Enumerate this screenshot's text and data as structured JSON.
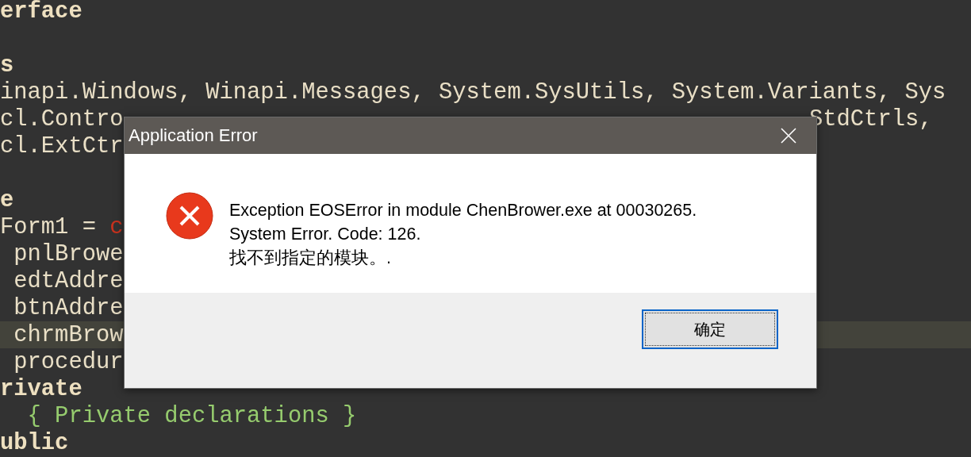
{
  "editor": {
    "lines": [
      {
        "left": [
          {
            "text": "erface",
            "kind": "keyword"
          }
        ],
        "current": false
      },
      {
        "current": false
      },
      {
        "left": [
          {
            "text": "s",
            "kind": "keyword"
          }
        ],
        "current": false
      },
      {
        "left": [
          {
            "text": "inapi.Windows, Winapi.Messages, System.SysUtils, System.Variants, Sys",
            "kind": "plain"
          }
        ],
        "current": false
      },
      {
        "left": [
          {
            "text": "cl.Contro",
            "kind": "plain"
          }
        ],
        "right": [
          {
            "text": "StdCtrls,",
            "kind": "plain"
          }
        ],
        "current": false
      },
      {
        "left": [
          {
            "text": "cl.ExtCtr",
            "kind": "plain"
          }
        ],
        "current": false
      },
      {
        "current": false
      },
      {
        "left": [
          {
            "text": "e",
            "kind": "keyword"
          }
        ],
        "current": false
      },
      {
        "left": [
          {
            "text": "Form1 = ",
            "kind": "plain"
          },
          {
            "text": "c",
            "kind": "string"
          }
        ],
        "current": false
      },
      {
        "left": [
          {
            "text": " pnlBrowe",
            "kind": "plain"
          }
        ],
        "current": false
      },
      {
        "left": [
          {
            "text": " edtAddre",
            "kind": "plain"
          }
        ],
        "current": false
      },
      {
        "left": [
          {
            "text": " btnAddre",
            "kind": "plain"
          }
        ],
        "current": false
      },
      {
        "left": [
          {
            "text": " chrmBrow",
            "kind": "plain"
          }
        ],
        "current": true
      },
      {
        "left": [
          {
            "text": " procedur",
            "kind": "plain"
          }
        ],
        "current": false
      },
      {
        "left": [
          {
            "text": "rivate",
            "kind": "keyword"
          }
        ],
        "current": false
      },
      {
        "left": [
          {
            "text": "  { Private declarations }",
            "kind": "comment"
          }
        ],
        "current": false
      },
      {
        "left": [
          {
            "text": "ublic",
            "kind": "keyword"
          }
        ],
        "current": false
      }
    ]
  },
  "dialog": {
    "title": "Application Error",
    "message": [
      "Exception EOSError in module ChenBrower.exe at 00030265.",
      "System Error.  Code: 126.",
      "找不到指定的模块。."
    ],
    "buttons": [
      {
        "label": "确定",
        "default": true
      }
    ]
  }
}
